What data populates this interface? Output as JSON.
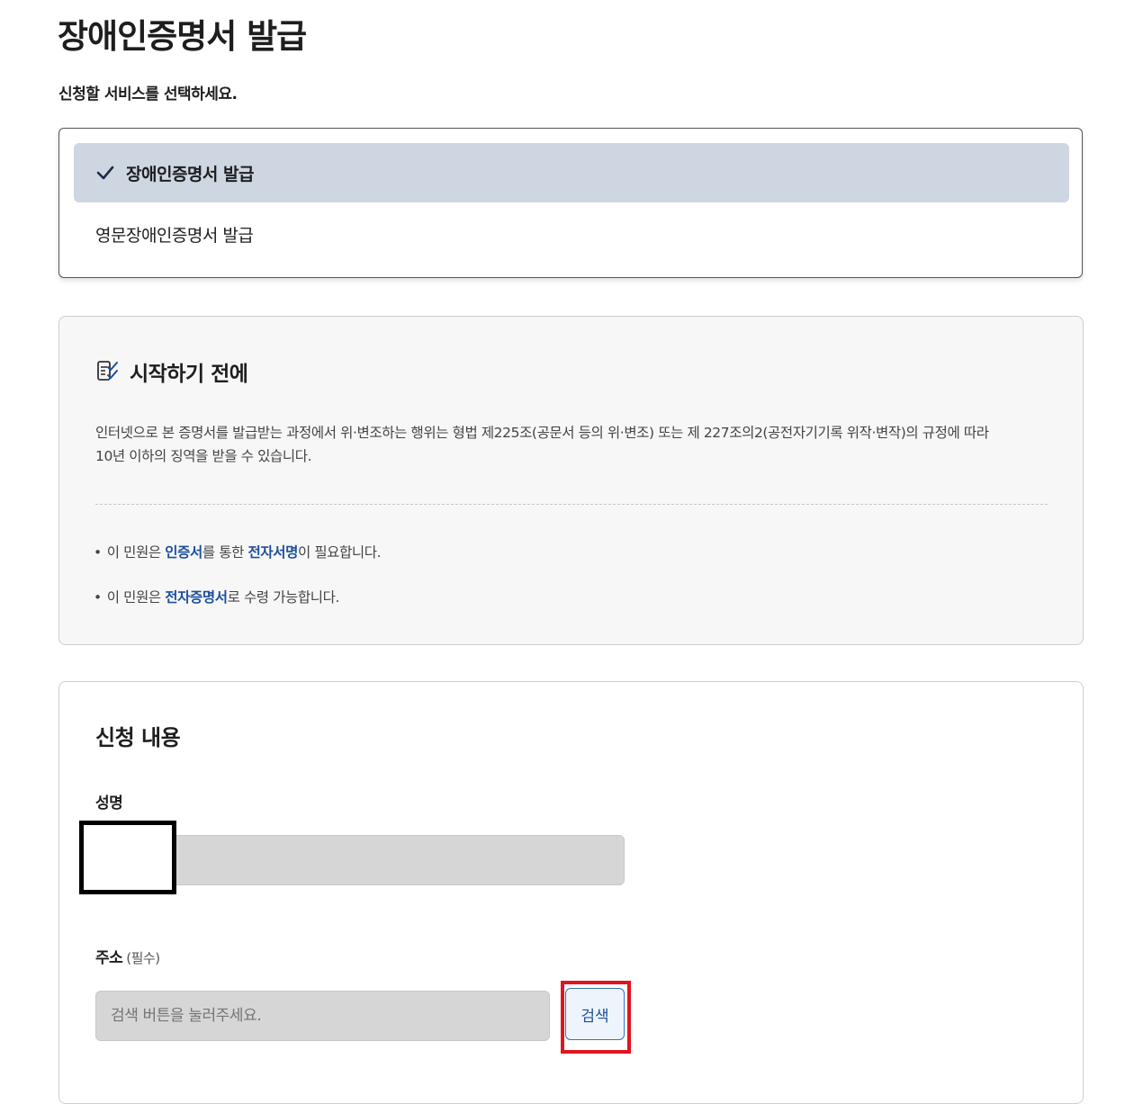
{
  "page": {
    "title": "장애인증명서 발급",
    "subtitle": "신청할 서비스를 선택하세요."
  },
  "services": {
    "selected": "장애인증명서 발급",
    "other": "영문장애인증명서 발급"
  },
  "before_start": {
    "heading": "시작하기 전에",
    "notice_line1": "인터넷으로 본 증명서를 발급받는 과정에서 위·변조하는 행위는 형법 제225조(공문서 등의 위·변조) 또는 제 227조의2(공전자기기록 위작·변작)의 규정에 따라",
    "notice_line2": "10년 이하의 징역을 받을 수 있습니다.",
    "bullet1": {
      "prefix": "이 민원은 ",
      "hl1": "인증서",
      "mid": "를 통한 ",
      "hl2": "전자서명",
      "suffix": "이 필요합니다."
    },
    "bullet2": {
      "prefix": "이 민원은 ",
      "hl1": "전자증명서",
      "suffix": "로 수령 가능합니다."
    }
  },
  "application": {
    "title": "신청 내용",
    "name_label": "성명",
    "address_label": "주소",
    "address_required": "(필수)",
    "address_placeholder": "검색 버튼을 눌러주세요.",
    "search_button": "검색"
  },
  "colors": {
    "selected_bg": "#cdd6e1",
    "link_blue": "#1d4f9c",
    "highlight_red": "#e0151f"
  }
}
